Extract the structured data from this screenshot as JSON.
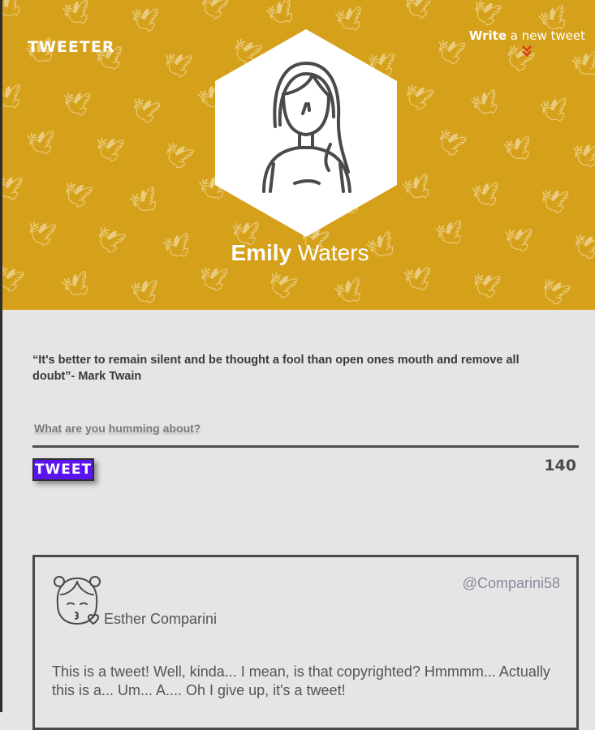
{
  "brand": {
    "name": "TWEETER"
  },
  "nav": {
    "write_bold": "Write",
    "write_rest": " a new tweet",
    "chevrons_icon": "double-chevron-down",
    "chevrons_color": "#d93a1a"
  },
  "profile": {
    "first_name": "Emily",
    "last_name": "Waters",
    "avatar_icon": "woman-outline-avatar",
    "header_color": "#d6a11a"
  },
  "compose": {
    "quote": "“It's better to remain silent and be thought a fool than open ones mouth and remove all doubt”- Mark Twain",
    "placeholder": "What are you humming about?",
    "button_label": "TWEET",
    "button_color": "#5b13f0",
    "char_count": "140"
  },
  "tweets": [
    {
      "avatar_icon": "girl-kiss-avatar",
      "name": "Esther Comparini",
      "handle": "@Comparini58",
      "text": "This is a tweet! Well, kinda... I mean, is that copyrighted? Hmmmm... Actually this is a... Um... A.... Oh I give up, it's a tweet!"
    }
  ]
}
